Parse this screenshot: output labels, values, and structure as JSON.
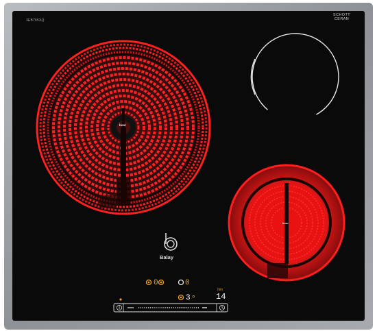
{
  "hob": {
    "model": "3EB755XQ",
    "glass_brand": "SCHOTT\nCERAN",
    "brand_name": "Balay",
    "zone_logo": "boor",
    "zone_logo_small": "boor"
  },
  "zones": [
    {
      "name": "rear-left",
      "state": "on"
    },
    {
      "name": "rear-right",
      "state": "off"
    },
    {
      "name": "front-right",
      "state": "on"
    }
  ],
  "controls": {
    "left_digit": "0",
    "mid_digit": "0",
    "power_level": "3",
    "timer_digits": "14",
    "timer_unit": "min"
  },
  "colors": {
    "glass": "#0a0a0b",
    "frame": "#9a9ea3",
    "heat": "#ff2020",
    "amber": "#f0a320"
  }
}
